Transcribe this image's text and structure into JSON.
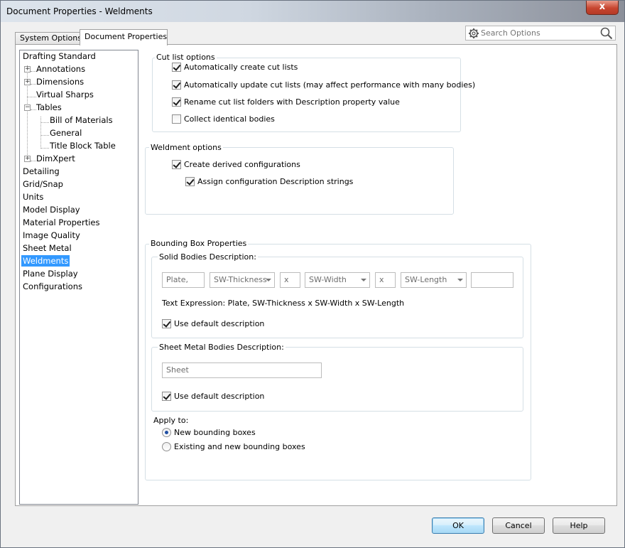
{
  "window": {
    "title": "Document Properties - Weldments",
    "close_label": "x"
  },
  "tabs": [
    {
      "label": "System Options"
    },
    {
      "label": "Document Properties"
    }
  ],
  "search": {
    "placeholder": "Search Options"
  },
  "tree": {
    "items": [
      {
        "label": "Drafting Standard"
      },
      {
        "label": "Annotations"
      },
      {
        "label": "Dimensions"
      },
      {
        "label": "Virtual Sharps"
      },
      {
        "label": "Tables"
      },
      {
        "label": "Bill of Materials"
      },
      {
        "label": "General"
      },
      {
        "label": "Title Block Table"
      },
      {
        "label": "DimXpert"
      },
      {
        "label": "Detailing"
      },
      {
        "label": "Grid/Snap"
      },
      {
        "label": "Units"
      },
      {
        "label": "Model Display"
      },
      {
        "label": "Material Properties"
      },
      {
        "label": "Image Quality"
      },
      {
        "label": "Sheet Metal"
      },
      {
        "label": "Weldments"
      },
      {
        "label": "Plane Display"
      },
      {
        "label": "Configurations"
      }
    ]
  },
  "cut_list": {
    "title": "Cut list options",
    "options": [
      {
        "label": "Automatically create cut lists",
        "checked": true
      },
      {
        "label": "Automatically update cut lists (may affect performance with many bodies)",
        "checked": true
      },
      {
        "label": "Rename cut list folders with Description property value",
        "checked": true
      },
      {
        "label": "Collect identical bodies",
        "checked": false
      }
    ]
  },
  "weldment": {
    "title": "Weldment options",
    "options": [
      {
        "label": "Create derived configurations",
        "checked": true
      },
      {
        "label": "Assign configuration Description strings",
        "checked": true
      }
    ]
  },
  "bounding_box": {
    "title": "Bounding Box Properties",
    "solid": {
      "title": "Solid Bodies Description:",
      "prefix": "Plate,",
      "thickness": "SW-Thickness",
      "sep1": "x",
      "width": "SW-Width",
      "sep2": "x",
      "length": "SW-Length",
      "suffix": "",
      "expression": "Text Expression: Plate, SW-Thickness x SW-Width x SW-Length",
      "use_default": "Use default description"
    },
    "sheet": {
      "title": "Sheet Metal Bodies Description:",
      "value": "Sheet",
      "use_default": "Use default description"
    },
    "apply_to": {
      "label": "Apply to:",
      "options": [
        {
          "label": "New bounding boxes",
          "checked": true
        },
        {
          "label": "Existing and new bounding boxes",
          "checked": false
        }
      ]
    }
  },
  "buttons": {
    "ok": "OK",
    "cancel": "Cancel",
    "help": "Help"
  }
}
